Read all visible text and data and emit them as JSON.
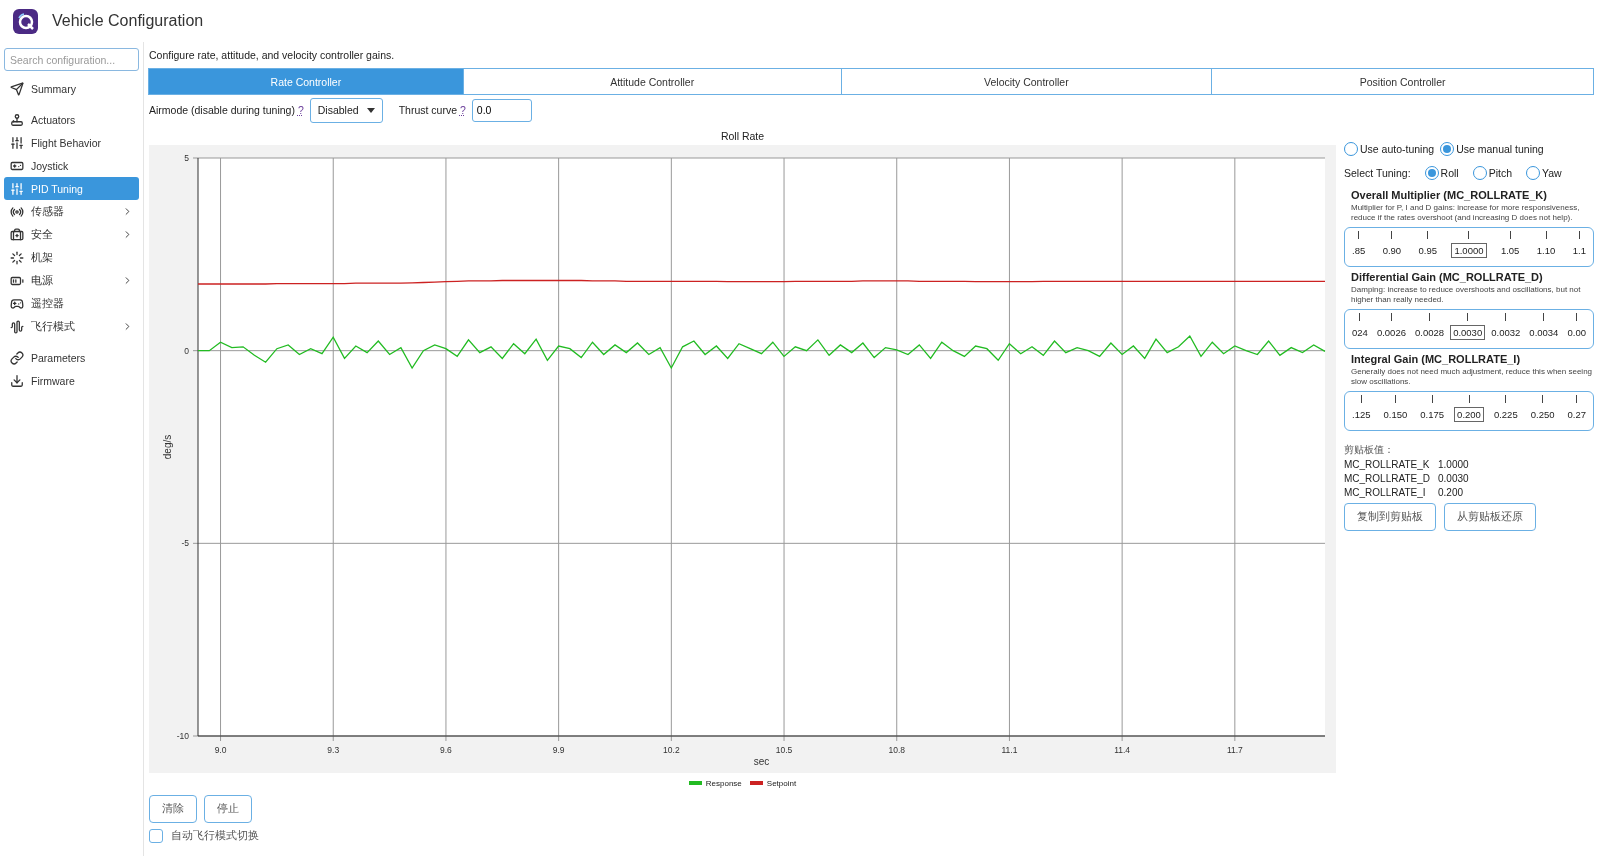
{
  "window": {
    "title": "Vehicle Configuration"
  },
  "sidebar": {
    "search": {
      "placeholder": "Search configuration..."
    },
    "groups": [
      [
        {
          "label": "Summary",
          "selected": false,
          "has_submenu": false
        }
      ],
      [
        {
          "label": "Actuators",
          "selected": false,
          "has_submenu": false
        },
        {
          "label": "Flight Behavior",
          "selected": false,
          "has_submenu": false
        },
        {
          "label": "Joystick",
          "selected": false,
          "has_submenu": false
        },
        {
          "label": "PID Tuning",
          "selected": true,
          "has_submenu": false
        },
        {
          "label": "传感器",
          "selected": false,
          "has_submenu": true
        },
        {
          "label": "安全",
          "selected": false,
          "has_submenu": true
        },
        {
          "label": "机架",
          "selected": false,
          "has_submenu": false
        },
        {
          "label": "电源",
          "selected": false,
          "has_submenu": true
        },
        {
          "label": "遥控器",
          "selected": false,
          "has_submenu": false
        },
        {
          "label": "飞行模式",
          "selected": false,
          "has_submenu": true
        }
      ],
      [
        {
          "label": "Parameters",
          "selected": false,
          "has_submenu": false
        },
        {
          "label": "Firmware",
          "selected": false,
          "has_submenu": false
        }
      ]
    ]
  },
  "description": "Configure rate, attitude, and velocity controller gains.",
  "tabs": [
    {
      "label": "Rate Controller",
      "selected": true
    },
    {
      "label": "Attitude Controller",
      "selected": false
    },
    {
      "label": "Velocity Controller",
      "selected": false
    },
    {
      "label": "Position Controller",
      "selected": false
    }
  ],
  "settings": {
    "airmode_label": "Airmode (disable during tuning)",
    "airmode_help": "?",
    "airmode_value": "Disabled",
    "thrust_label": "Thrust curve",
    "thrust_help": "?",
    "thrust_value": "0.0"
  },
  "chart": {
    "chart_data": {
      "type": "line",
      "grid": true,
      "title": "Roll Rate",
      "xlabel": "sec",
      "ylabel": "deg/s",
      "xlim": [
        8.94,
        11.94
      ],
      "ylim": [
        -10,
        5
      ],
      "xticks": [
        {
          "value": 9,
          "label": "9.0"
        },
        9.3,
        9.6,
        9.9,
        10.2,
        10.5,
        10.8,
        11.1,
        11.4,
        11.7
      ],
      "yticks": [
        5,
        0,
        -5,
        -10
      ],
      "x": [
        8.94,
        8.97,
        9.0,
        9.03,
        9.06,
        9.09,
        9.12,
        9.15,
        9.18,
        9.21,
        9.24,
        9.27,
        9.3,
        9.33,
        9.36,
        9.39,
        9.42,
        9.45,
        9.48,
        9.51,
        9.54,
        9.57,
        9.6,
        9.63,
        9.66,
        9.69,
        9.72,
        9.75,
        9.78,
        9.81,
        9.84,
        9.87,
        9.9,
        9.93,
        9.96,
        9.99,
        10.02,
        10.05,
        10.08,
        10.11,
        10.14,
        10.17,
        10.2,
        10.23,
        10.26,
        10.29,
        10.32,
        10.35,
        10.38,
        10.41,
        10.44,
        10.47,
        10.5,
        10.53,
        10.56,
        10.59,
        10.62,
        10.65,
        10.68,
        10.71,
        10.74,
        10.77,
        10.8,
        10.83,
        10.86,
        10.89,
        10.92,
        10.95,
        10.98,
        11.01,
        11.04,
        11.07,
        11.1,
        11.13,
        11.16,
        11.19,
        11.22,
        11.25,
        11.28,
        11.31,
        11.34,
        11.37,
        11.4,
        11.43,
        11.46,
        11.49,
        11.52,
        11.55,
        11.58,
        11.61,
        11.64,
        11.67,
        11.7,
        11.73,
        11.76,
        11.79,
        11.82,
        11.85,
        11.88,
        11.91,
        11.94
      ],
      "series": [
        {
          "name": "Response",
          "color": "#22bb22",
          "values": [
            0,
            0,
            0.22,
            0.08,
            0.1,
            -0.12,
            -0.3,
            0.05,
            0.15,
            -0.1,
            0.05,
            -0.08,
            0.35,
            -0.2,
            0.12,
            -0.05,
            0.25,
            -0.1,
            0.08,
            -0.45,
            0,
            0.15,
            0.05,
            -0.15,
            0.28,
            -0.05,
            0.1,
            -0.2,
            0.18,
            -0.08,
            0.3,
            -0.25,
            0.12,
            0.05,
            -0.18,
            0.22,
            -0.1,
            0.15,
            -0.05,
            0.2,
            -0.1,
            0.08,
            -0.45,
            0.1,
            0.25,
            -0.1,
            0.12,
            -0.2,
            0.18,
            0.05,
            -0.08,
            0.22,
            -0.15,
            0.1,
            0,
            0.28,
            -0.12,
            0.15,
            -0.05,
            0.2,
            -0.18,
            0.08,
            0.02,
            -0.1,
            0.15,
            -0.2,
            0.22,
            0,
            -0.15,
            0.12,
            0.05,
            -0.25,
            0.18,
            -0.08,
            0.1,
            -0.12,
            0.25,
            -0.05,
            0.08,
            0,
            -0.15,
            0.2,
            -0.1,
            0.12,
            -0.2,
            0.3,
            -0.05,
            0.1,
            0.38,
            -0.15,
            0.22,
            -0.08,
            0.12,
            0,
            -0.1,
            0.25,
            -0.12,
            0.08,
            -0.05,
            0.15,
            -0.02
          ]
        },
        {
          "name": "Setpoint",
          "color": "#cc2222",
          "values": [
            1.73,
            1.73,
            1.73,
            1.73,
            1.73,
            1.73,
            1.73,
            1.74,
            1.74,
            1.74,
            1.74,
            1.74,
            1.74,
            1.74,
            1.75,
            1.75,
            1.75,
            1.75,
            1.75,
            1.76,
            1.77,
            1.78,
            1.79,
            1.8,
            1.81,
            1.81,
            1.81,
            1.82,
            1.82,
            1.82,
            1.82,
            1.82,
            1.82,
            1.82,
            1.82,
            1.81,
            1.81,
            1.81,
            1.8,
            1.8,
            1.8,
            1.8,
            1.8,
            1.8,
            1.8,
            1.8,
            1.8,
            1.79,
            1.79,
            1.79,
            1.79,
            1.79,
            1.79,
            1.8,
            1.8,
            1.8,
            1.8,
            1.8,
            1.8,
            1.81,
            1.81,
            1.81,
            1.81,
            1.81,
            1.8,
            1.8,
            1.8,
            1.8,
            1.8,
            1.79,
            1.79,
            1.79,
            1.79,
            1.79,
            1.79,
            1.8,
            1.8,
            1.8,
            1.8,
            1.8,
            1.8,
            1.8,
            1.8,
            1.8,
            1.8,
            1.8,
            1.8,
            1.8,
            1.8,
            1.8,
            1.8,
            1.8,
            1.8,
            1.8,
            1.8,
            1.8,
            1.8,
            1.8,
            1.8,
            1.8,
            1.8
          ]
        }
      ]
    }
  },
  "actions": [
    {
      "label": "清除"
    },
    {
      "label": "停止"
    }
  ],
  "auto_switch": {
    "label": "自动飞行模式切换",
    "checked": false
  },
  "tuning": {
    "modes": [
      {
        "label": "Use auto-tuning",
        "selected": false
      },
      {
        "label": "Use manual tuning",
        "selected": true
      }
    ],
    "select_label": "Select Tuning:",
    "axes": [
      {
        "label": "Roll",
        "selected": true
      },
      {
        "label": "Pitch",
        "selected": false
      },
      {
        "label": "Yaw",
        "selected": false
      }
    ],
    "params": [
      {
        "title": "Overall Multiplier (MC_ROLLRATE_K)",
        "description": "Multiplier for P, I and D gains: increase for more responsiveness, reduce if the rates overshoot (and increasing D does not help).",
        "ticks": [
          {
            "label": ".85",
            "selected": false
          },
          {
            "label": "0.90",
            "selected": false
          },
          {
            "label": "0.95",
            "selected": false
          },
          {
            "label": "1.0000",
            "selected": true
          },
          {
            "label": "1.05",
            "selected": false
          },
          {
            "label": "1.10",
            "selected": false
          },
          {
            "label": "1.1",
            "selected": false
          }
        ]
      },
      {
        "title": "Differential Gain (MC_ROLLRATE_D)",
        "description": "Damping: increase to reduce overshoots and oscillations, but not higher than really needed.",
        "ticks": [
          {
            "label": "024",
            "selected": false
          },
          {
            "label": "0.0026",
            "selected": false
          },
          {
            "label": "0.0028",
            "selected": false
          },
          {
            "label": "0.0030",
            "selected": true
          },
          {
            "label": "0.0032",
            "selected": false
          },
          {
            "label": "0.0034",
            "selected": false
          },
          {
            "label": "0.00",
            "selected": false
          }
        ]
      },
      {
        "title": "Integral Gain (MC_ROLLRATE_I)",
        "description": "Generally does not need much adjustment, reduce this when seeing slow oscillations.",
        "ticks": [
          {
            "label": ".125",
            "selected": false
          },
          {
            "label": "0.150",
            "selected": false
          },
          {
            "label": "0.175",
            "selected": false
          },
          {
            "label": "0.200",
            "selected": true
          },
          {
            "label": "0.225",
            "selected": false
          },
          {
            "label": "0.250",
            "selected": false
          },
          {
            "label": "0.27",
            "selected": false
          }
        ]
      }
    ],
    "clipboard": {
      "title": "剪贴板值：",
      "rows": [
        {
          "name": "MC_ROLLRATE_K",
          "value": "1.0000"
        },
        {
          "name": "MC_ROLLRATE_D",
          "value": "0.0030"
        },
        {
          "name": "MC_ROLLRATE_I",
          "value": "0.200"
        }
      ],
      "buttons": [
        {
          "label": "复制到剪贴板"
        },
        {
          "label": "从剪贴板还原"
        }
      ]
    }
  }
}
